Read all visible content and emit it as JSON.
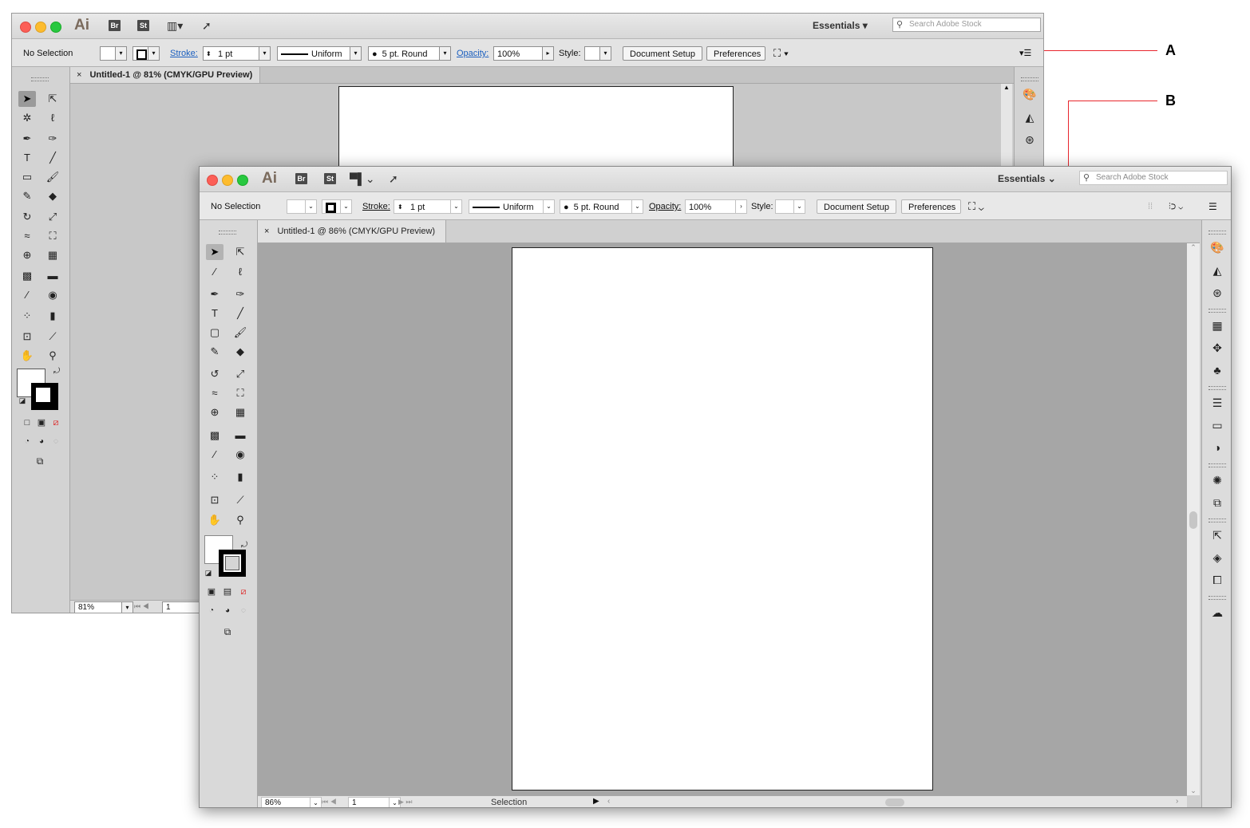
{
  "callouts": {
    "a": "A",
    "b": "B"
  },
  "app": {
    "logo": "Ai",
    "bridge": "Br",
    "stock": "St",
    "workspace": "Essentials",
    "search_placeholder": "Search Adobe Stock"
  },
  "control_bar": {
    "selection": "No Selection",
    "stroke_label": "Stroke:",
    "stroke_value": "1 pt",
    "profile": "Uniform",
    "brush": "5 pt. Round",
    "opacity_label": "Opacity:",
    "opacity_value": "100%",
    "style_label": "Style:",
    "document_setup": "Document Setup",
    "preferences": "Preferences"
  },
  "window_a": {
    "tab_title": "Untitled-1 @ 81% (CMYK/GPU Preview)",
    "zoom": "81%",
    "page": "1"
  },
  "window_b": {
    "tab_title": "Untitled-1 @ 86% (CMYK/GPU Preview)",
    "zoom": "86%",
    "page": "1",
    "status": "Selection"
  },
  "colors": {
    "callout_line": "#e8262d",
    "canvas": "#a6a6a6",
    "panel": "#d3d3d3"
  }
}
